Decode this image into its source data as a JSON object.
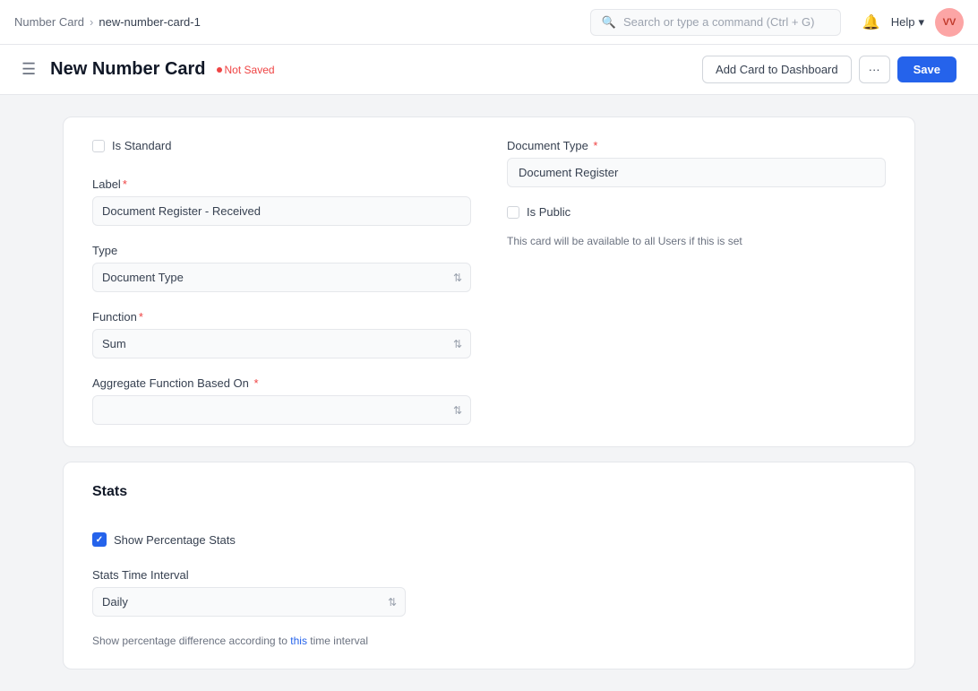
{
  "nav": {
    "breadcrumb": {
      "parent": "Number Card",
      "child": "new-number-card-1"
    },
    "search_placeholder": "Search or type a command (Ctrl + G)",
    "help_label": "Help",
    "avatar_initials": "VV"
  },
  "header": {
    "menu_icon": "☰",
    "title": "New Number Card",
    "not_saved_label": "Not Saved",
    "add_card_label": "Add Card to Dashboard",
    "more_icon": "•••",
    "save_label": "Save"
  },
  "form": {
    "is_standard_label": "Is Standard",
    "label_field_label": "Label",
    "label_required": "*",
    "label_value": "Document Register - Received",
    "type_field_label": "Type",
    "type_value": "Document Type",
    "function_field_label": "Function",
    "function_required": "*",
    "function_value": "Sum",
    "aggregate_field_label": "Aggregate Function Based On",
    "aggregate_required": "*",
    "aggregate_value": "",
    "document_type_label": "Document Type",
    "document_type_required": "*",
    "document_type_value": "Document Register",
    "is_public_label": "Is Public",
    "is_public_hint": "This card will be available to all Users if this is set"
  },
  "stats": {
    "title": "Stats",
    "show_percentage_label": "Show Percentage Stats",
    "stats_time_interval_label": "Stats Time Interval",
    "stats_time_value": "Daily",
    "hint_text_before": "Show percentage difference according to",
    "hint_link": "this",
    "hint_text_after": "time interval"
  }
}
